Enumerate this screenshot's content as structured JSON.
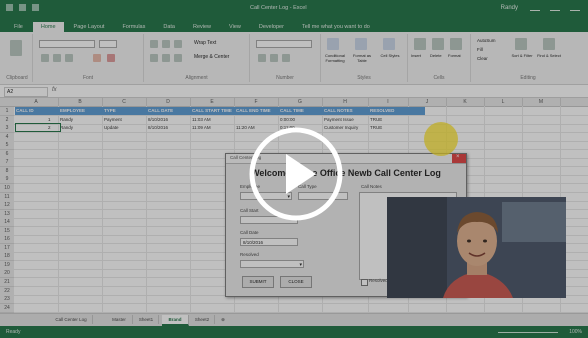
{
  "window": {
    "title": "Call Center Log - Excel",
    "user": "Randy"
  },
  "tabs": [
    "File",
    "Home",
    "Page Layout",
    "Formulas",
    "Data",
    "Review",
    "View",
    "Developer",
    "Tell me what you want to do"
  ],
  "active_tab": "Home",
  "ribbon_groups": [
    "Clipboard",
    "Font",
    "Alignment",
    "Number",
    "Styles",
    "Cells",
    "Editing"
  ],
  "ribbon_buttons": [
    "Wrap Text",
    "Merge & Center",
    "Conditional Formatting",
    "Format as Table",
    "Cell Styles",
    "Insert",
    "Delete",
    "Format",
    "AutoSum",
    "Fill",
    "Clear",
    "Sort & Filter",
    "Find & Select"
  ],
  "formula_bar": {
    "name_box": "A2",
    "fx": "fx"
  },
  "columns": [
    "A",
    "B",
    "C",
    "D",
    "E",
    "F",
    "G",
    "H",
    "I",
    "J",
    "K",
    "L",
    "M"
  ],
  "rows": [
    "1",
    "2",
    "3",
    "4",
    "5",
    "6",
    "7",
    "8",
    "9",
    "10",
    "11",
    "12",
    "13",
    "14",
    "15",
    "16",
    "17",
    "18",
    "19",
    "20",
    "21",
    "22",
    "23",
    "24"
  ],
  "table": {
    "headers": [
      "CALL ID",
      "EMPLOYEE",
      "TYPE",
      "CALL DATE",
      "CALL START TIME",
      "CALL END TIME",
      "CALL TIME",
      "CALL NOTES",
      "RESOLVED"
    ],
    "rows": [
      [
        "1",
        "Randy",
        "Payment",
        "8/10/2016",
        "11:03 AM",
        "",
        "0:00:00",
        "Payment Issue",
        "TRUE"
      ],
      [
        "2",
        "Randy",
        "Update",
        "8/10/2016",
        "11:09 AM",
        "11:20 AM",
        "0:11:00",
        "Customer Inquiry",
        "TRUE"
      ]
    ]
  },
  "form": {
    "caption": "Call Center Log",
    "title": "Welcome to the Office Newb Call Center Log",
    "labels": {
      "employee": "Employee",
      "call_type": "Call Type",
      "call_date": "Call Date",
      "call_start": "Call Start",
      "resolved": "Resolved",
      "notes": "Call Notes",
      "resolved_check": "Resolved"
    },
    "values": {
      "call_date": "8/10/2016"
    },
    "buttons": {
      "submit": "SUBMIT",
      "close": "CLOSE"
    }
  },
  "sheet_tabs": [
    "Call Center Log",
    "Master",
    "Sheet1",
    "Brand",
    "Sheet2"
  ],
  "active_sheet": "Brand",
  "status": {
    "ready": "Ready",
    "zoom": "100%"
  },
  "colors": {
    "excel_green": "#217346",
    "header_blue": "#5b9bd5",
    "play": "#ffffff"
  },
  "icons": [
    "play-icon",
    "close-icon",
    "dropdown-icon",
    "save-icon",
    "undo-icon",
    "redo-icon"
  ]
}
